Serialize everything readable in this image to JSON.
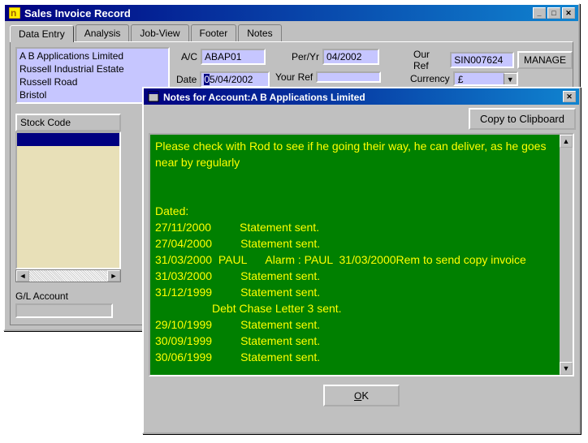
{
  "mainWindow": {
    "title": "Sales Invoice Record",
    "tabs": [
      "Data Entry",
      "Analysis",
      "Job-View",
      "Footer",
      "Notes"
    ],
    "activeTab": 0,
    "address": [
      "A B Applications Limited",
      "Russell Industrial Estate",
      "Russell Road",
      "Bristol"
    ],
    "fields": {
      "ac_label": "A/C",
      "ac_value": "ABAP01",
      "peryr_label": "Per/Yr",
      "peryr_value": "04/2002",
      "ourref_label": "Our Ref",
      "ourref_value": "SIN007624",
      "manage_label": "MANAGE",
      "date_label": "Date",
      "date_value": "05/04/2002",
      "yourref_label": "Your Ref",
      "yourref_value": "",
      "currency_label": "Currency",
      "currency_value": "£"
    },
    "stockHeader": "Stock Code",
    "gl_label": "G/L Account"
  },
  "notesWindow": {
    "title_prefix": "Notes for Account:",
    "title_account": "A B Applications Limited",
    "copy_label": "Copy to Clipboard",
    "ok_label": "OK",
    "body": "Please check with Rod to see if he going their way, he can deliver, as he goes near by regularly\n\n\nDated:\n27/11/2000         Statement sent.\n27/04/2000         Statement sent.\n31/03/2000  PAUL      Alarm : PAUL  31/03/2000Rem to send copy invoice\n31/03/2000         Statement sent.\n31/12/1999         Statement sent.\n                  Debt Chase Letter 3 sent.\n29/10/1999         Statement sent.\n30/09/1999         Statement sent.\n30/06/1999         Statement sent."
  }
}
